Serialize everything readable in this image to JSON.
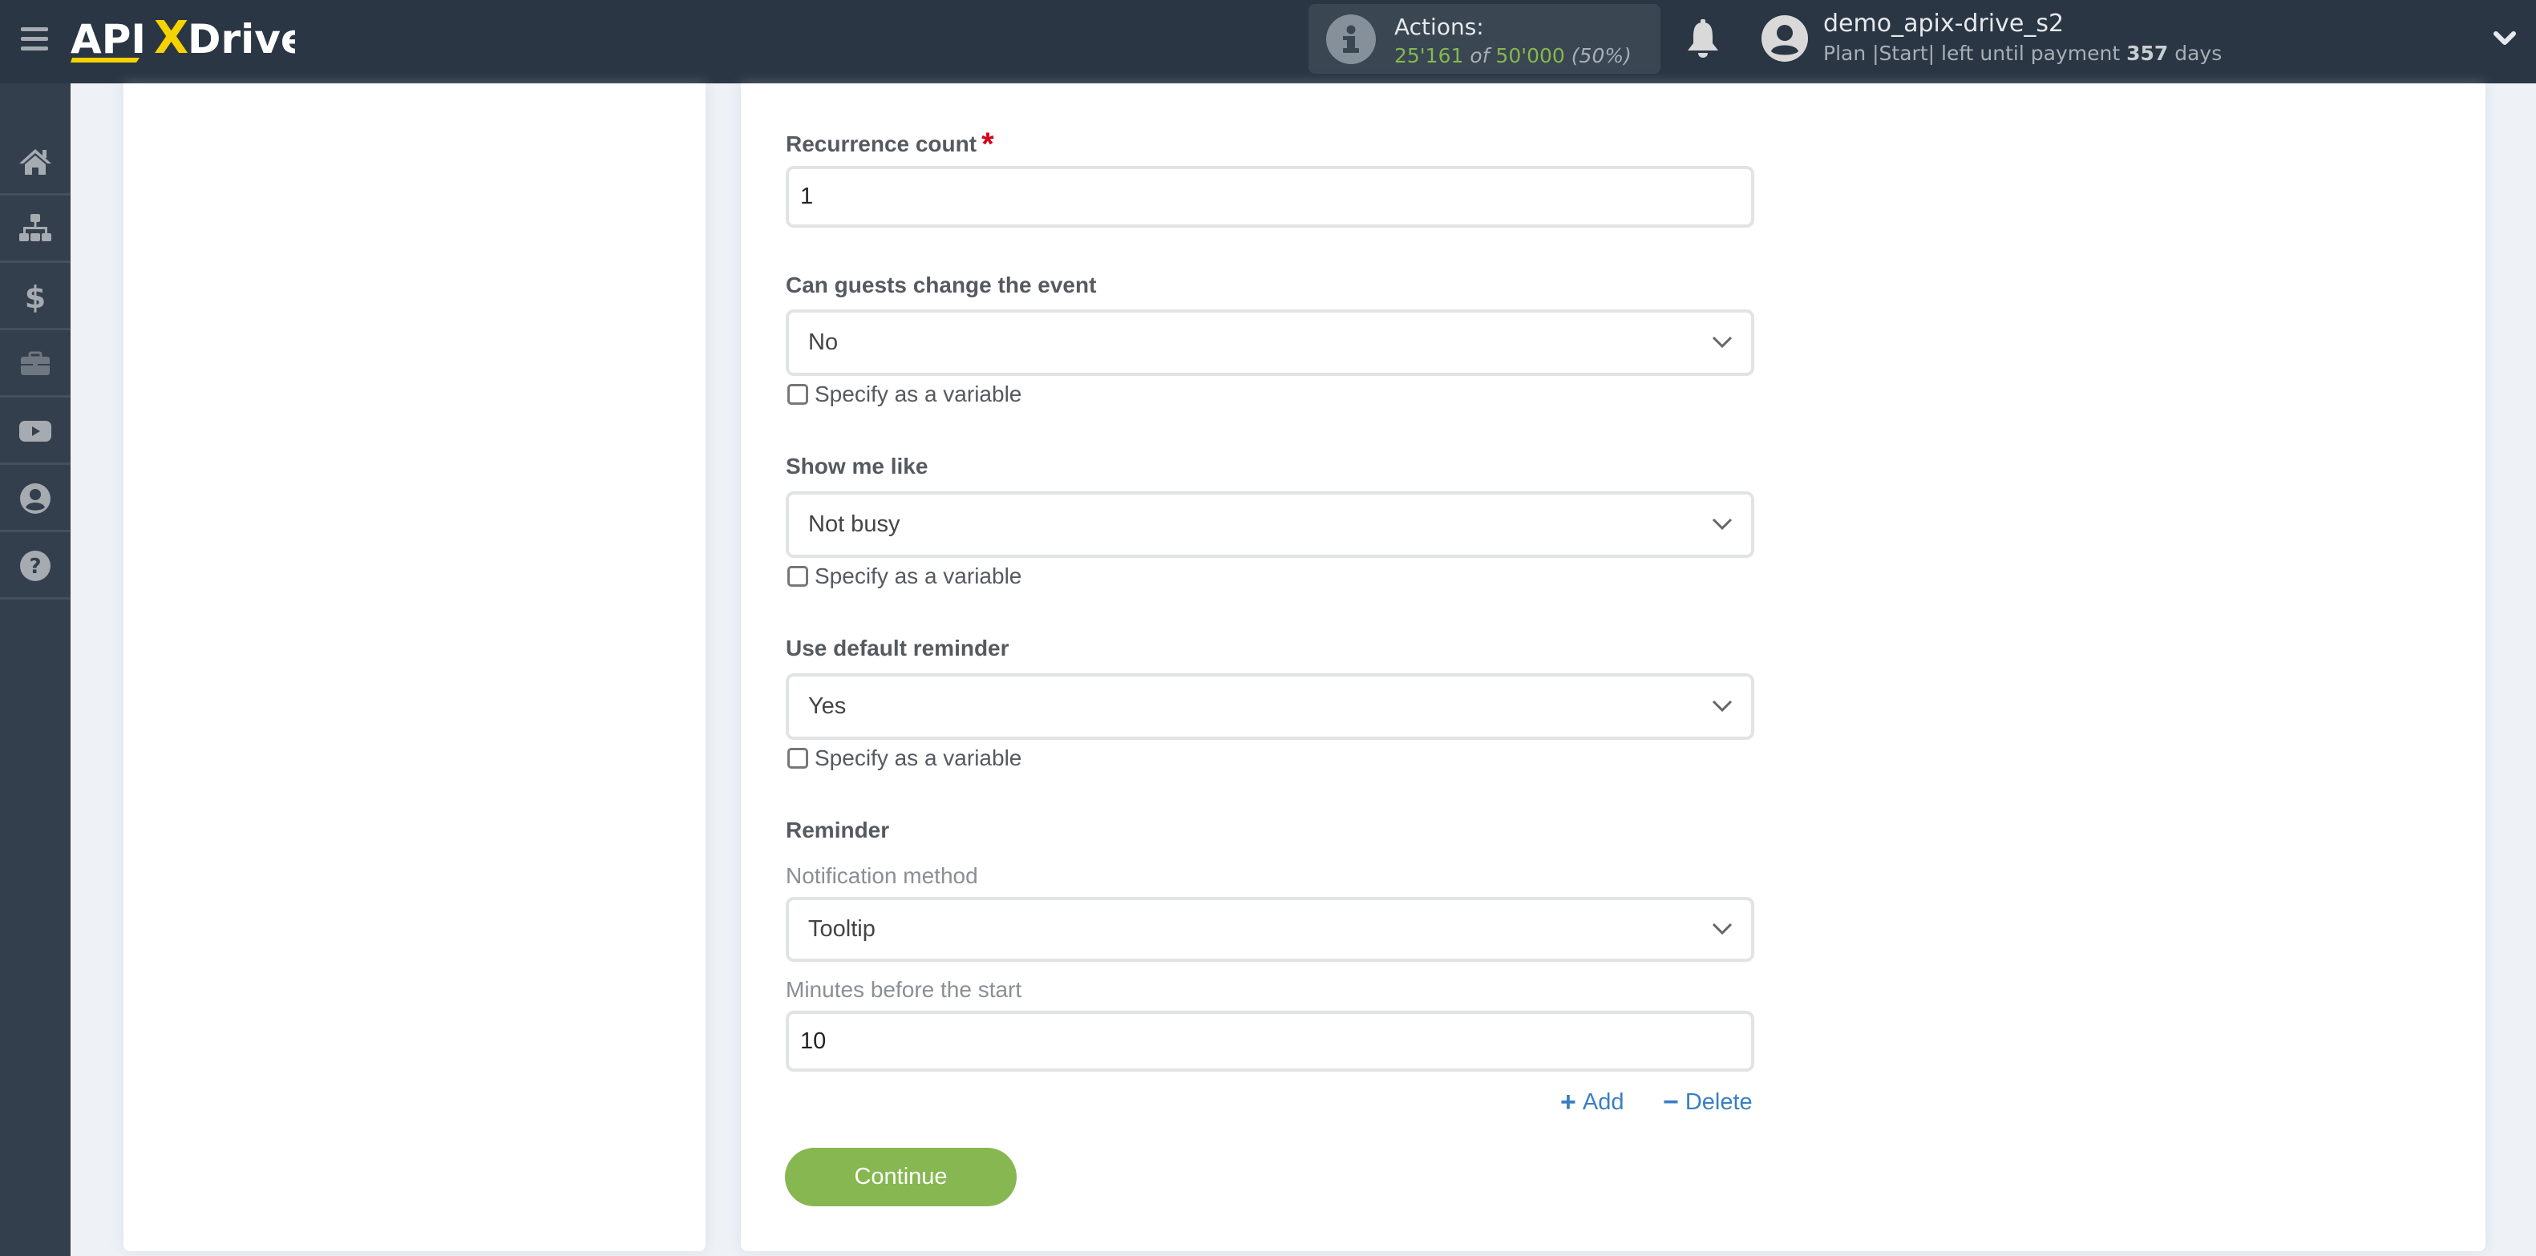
{
  "header": {
    "logo_text_left": "API",
    "logo_text_x": "X",
    "logo_text_right": "Drive",
    "actions": {
      "title": "Actions:",
      "used": "25'161",
      "of": "of",
      "total": "50'000",
      "percent": "(50%)"
    },
    "user": {
      "name": "demo_apix-drive_s2",
      "plan_prefix": "Plan |Start| left until payment",
      "days_left": "357",
      "days_suffix": "days"
    }
  },
  "sidebar": {
    "items": [
      {
        "icon": "home-icon"
      },
      {
        "icon": "sitemap-icon"
      },
      {
        "icon": "dollar-icon"
      },
      {
        "icon": "briefcase-icon"
      },
      {
        "icon": "youtube-icon"
      },
      {
        "icon": "user-circle-icon"
      },
      {
        "icon": "question-circle-icon"
      }
    ]
  },
  "form": {
    "recurrence_count": {
      "label": "Recurrence count",
      "required_mark": "*",
      "value": "1"
    },
    "guests_change": {
      "label": "Can guests change the event",
      "value": "No",
      "checkbox_label": "Specify as a variable",
      "checked": false
    },
    "show_me_like": {
      "label": "Show me like",
      "value": "Not busy",
      "checkbox_label": "Specify as a variable",
      "checked": false
    },
    "default_reminder": {
      "label": "Use default reminder",
      "value": "Yes",
      "checkbox_label": "Specify as a variable",
      "checked": false
    },
    "reminder": {
      "label": "Reminder",
      "notification_method": {
        "label": "Notification method",
        "value": "Tooltip"
      },
      "minutes_before": {
        "label": "Minutes before the start",
        "value": "10"
      },
      "add_label": "Add",
      "delete_label": "Delete"
    },
    "continue_label": "Continue"
  },
  "colors": {
    "header_bg": "#2b3644",
    "sidebar_bg": "#343f4d",
    "accent_green": "#86b750",
    "logo_yellow": "#f5d300",
    "link_blue": "#3a7fc1",
    "required_red": "#d0021b"
  }
}
